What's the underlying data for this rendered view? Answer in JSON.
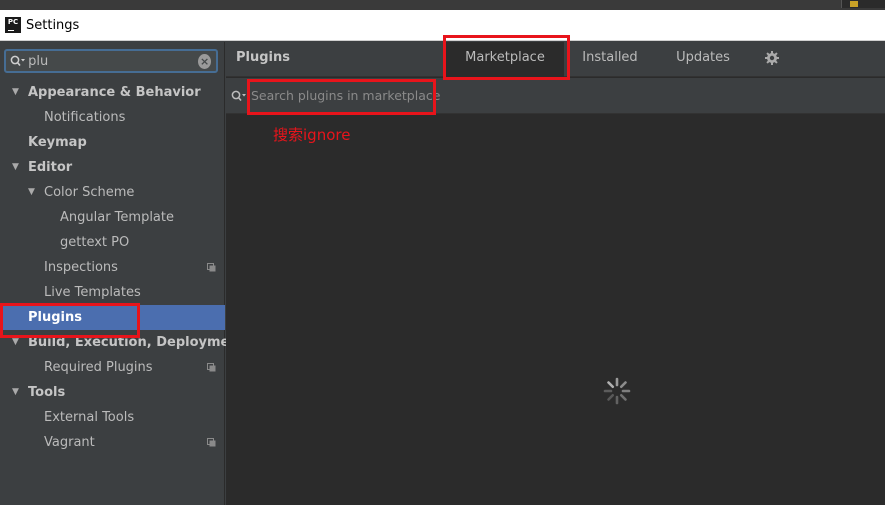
{
  "window": {
    "title": "Settings",
    "app_icon_text": "PC"
  },
  "sidebar": {
    "search": {
      "value": "plu",
      "placeholder": ""
    },
    "items": [
      {
        "label": "Appearance & Behavior",
        "level": 0,
        "expanded": true,
        "bold": true
      },
      {
        "label": "Notifications",
        "level": 1
      },
      {
        "label": "Keymap",
        "level": 0,
        "bold": true
      },
      {
        "label": "Editor",
        "level": 0,
        "expanded": true,
        "bold": true
      },
      {
        "label": "Color Scheme",
        "level": 1,
        "expanded": true
      },
      {
        "label": "Angular Template",
        "level": 2
      },
      {
        "label": "gettext PO",
        "level": 2
      },
      {
        "label": "Inspections",
        "level": 1,
        "copy_icon": true
      },
      {
        "label": "Live Templates",
        "level": 1
      },
      {
        "label": "Plugins",
        "level": 0,
        "bold": true,
        "selected": true
      },
      {
        "label": "Build, Execution, Deployment",
        "level": 0,
        "expanded": true,
        "bold": true
      },
      {
        "label": "Required Plugins",
        "level": 1,
        "copy_icon": true
      },
      {
        "label": "Tools",
        "level": 0,
        "expanded": true,
        "bold": true
      },
      {
        "label": "External Tools",
        "level": 1
      },
      {
        "label": "Vagrant",
        "level": 1,
        "copy_icon": true
      }
    ]
  },
  "main": {
    "title": "Plugins",
    "tabs": [
      {
        "label": "Marketplace",
        "active": true
      },
      {
        "label": "Installed",
        "active": false
      },
      {
        "label": "Updates",
        "active": false
      }
    ],
    "settings_icon": "gear-icon",
    "search": {
      "placeholder": "Search plugins in marketplace",
      "value": ""
    },
    "loading_icon": "spinner-icon"
  },
  "annotation": {
    "text": "搜索ignore",
    "color": "#e8141b"
  },
  "colors": {
    "selection": "#4b6eaf",
    "panel": "#3c3f41",
    "content": "#2b2b2b"
  }
}
